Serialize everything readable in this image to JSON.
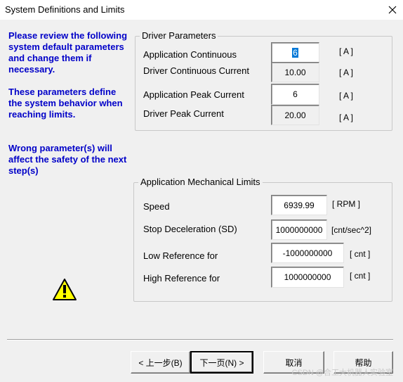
{
  "window": {
    "title": "System Definitions and Limits",
    "close_glyph": "✕"
  },
  "info": {
    "p1": "Please review the following system default parameters and change them if necessary.",
    "p2": "These parameters define the system behavior when reaching limits.",
    "p3": "Wrong parameter(s) will affect the safety of the next step(s)"
  },
  "driver": {
    "group_title": "Driver Parameters",
    "app_continuous_label": "Application  Continuous",
    "app_continuous_value": "6",
    "driver_continuous_label": "Driver Continuous Current",
    "driver_continuous_value": "10.00",
    "app_peak_label": "Application  Peak Current",
    "app_peak_value": "6",
    "driver_peak_label": "Driver Peak Current",
    "driver_peak_value": "20.00",
    "unit": "[ A ]"
  },
  "mechanical": {
    "group_title": "Application Mechanical Limits",
    "speed_label": "Speed",
    "speed_value": "6939.99",
    "speed_unit": "[ RPM ]",
    "stop_decel_label": "Stop Deceleration (SD)",
    "stop_decel_value": "1000000000",
    "stop_decel_unit": "[cnt/sec^2]",
    "low_ref_label": "Low Reference for",
    "low_ref_value": "-1000000000",
    "low_ref_unit": "[ cnt ]",
    "high_ref_label": "High Reference for",
    "high_ref_value": "1000000000",
    "high_ref_unit": "[ cnt ]"
  },
  "buttons": {
    "back": "< 上一步(B)",
    "next": "下一页(N) >",
    "cancel": "取消",
    "help": "帮助"
  },
  "watermark": "CSDN @合工大机器人实验室",
  "colors": {
    "info_text": "#0000c8",
    "dialog_bg": "#f0f0f0",
    "warning": "#ffff00"
  },
  "icons": {
    "warning": "warning-icon",
    "close": "close-icon"
  }
}
